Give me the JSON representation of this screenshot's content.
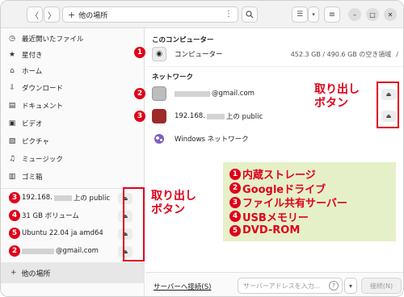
{
  "header": {
    "back_icon": "chevron-left-icon",
    "forward_icon": "chevron-right-icon",
    "path_label": "他の場所",
    "path_icon": "plus-icon",
    "menu_icon": "vertical-dots-icon",
    "search_icon": "search-icon",
    "view_icon": "list-view-icon",
    "view_dropdown_icon": "chevron-down-icon",
    "menu_btn_icon": "hamburger-icon",
    "minimize_icon": "minimize-icon",
    "maximize_icon": "maximize-icon",
    "close_icon": "close-icon"
  },
  "sidebar": {
    "items": [
      {
        "label": "最近開いたファイル",
        "icon": "clock-icon"
      },
      {
        "label": "星付き",
        "icon": "star-icon"
      },
      {
        "label": "ホーム",
        "icon": "home-icon"
      },
      {
        "label": "ダウンロード",
        "icon": "download-icon"
      },
      {
        "label": "ドキュメント",
        "icon": "document-icon"
      },
      {
        "label": "ビデオ",
        "icon": "video-icon"
      },
      {
        "label": "ピクチャ",
        "icon": "picture-icon"
      },
      {
        "label": "ミュージック",
        "icon": "music-icon"
      },
      {
        "label": "ゴミ箱",
        "icon": "trash-icon"
      }
    ],
    "devices": [
      {
        "label_prefix": "192.168.",
        "label_suffix": "上の public",
        "icon": "network-drive-icon",
        "badge": "3"
      },
      {
        "label": "31 GB ボリューム",
        "icon": "usb-drive-icon",
        "badge": "4"
      },
      {
        "label": "Ubuntu 22.04 ja amd64",
        "icon": "optical-disc-icon",
        "badge": "5"
      },
      {
        "label_suffix": "@gmail.com",
        "icon": "cloud-drive-icon",
        "badge": "2"
      }
    ],
    "other_places": "他の場所"
  },
  "main": {
    "this_computer_title": "このコンピューター",
    "computer": {
      "label": "コンピューター",
      "meta": "452.3 GB / 490.6 GB の空き領域",
      "slash": "/",
      "badge": "1"
    },
    "network_title": "ネットワーク",
    "network": [
      {
        "label_suffix": "@gmail.com",
        "badge": "2"
      },
      {
        "label_prefix": "192.168.",
        "label_suffix": "上の public",
        "badge": "3"
      },
      {
        "label": "Windows ネットワーク"
      }
    ],
    "bottom": {
      "connect_label": "サーバーへ接続(S)",
      "server_placeholder": "サーバーアドレスを入力...",
      "connect_button": "接続(N)"
    }
  },
  "annotations": {
    "eject_label_line1": "取り出し",
    "eject_label_line2": "ボタン",
    "legend": [
      {
        "num": "1",
        "text": "内蔵ストレージ"
      },
      {
        "num": "2",
        "text": "Googleドライブ"
      },
      {
        "num": "3",
        "text": "ファイル共有サーバー"
      },
      {
        "num": "4",
        "text": "USBメモリー"
      },
      {
        "num": "5",
        "text": "DVD-ROM"
      }
    ],
    "accent_color": "#e0001a",
    "legend_bg": "#e6f0c8"
  }
}
